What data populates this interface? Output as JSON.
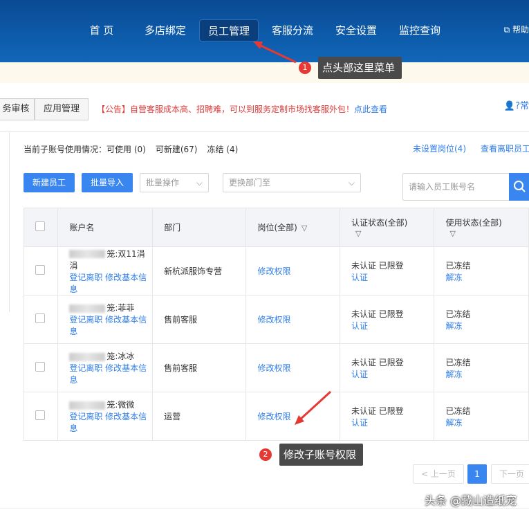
{
  "nav": {
    "items": [
      "首 页",
      "多店绑定",
      "员工管理",
      "客服分流",
      "安全设置",
      "监控查询"
    ],
    "active_index": 2,
    "help": "帮助"
  },
  "callouts": [
    {
      "num": "1",
      "text": "点头部这里菜单"
    },
    {
      "num": "2",
      "text": "修改子账号权限"
    }
  ],
  "tabs": [
    "务审核",
    "应用管理"
  ],
  "announcement": {
    "text": "【公告】自营客服成本高、招聘难，可以到服务定制市场找客服外包！",
    "link": "点此查看"
  },
  "question_help": "常",
  "stats": {
    "prefix": "当前子账号使用情况：",
    "available": "可使用 (0)",
    "can_create": "可新建(67)",
    "frozen": "冻结 (4)"
  },
  "right_links": [
    "未设置岗位(4)",
    "查看离职员工"
  ],
  "toolbar": {
    "new_employee": "新建员工",
    "batch_import": "批量导入",
    "batch_ops": "批量操作",
    "change_dept": "更换部门至",
    "search_placeholder": "请输入员工账号名"
  },
  "table": {
    "headers": [
      "账户名",
      "部门",
      "岗位(全部)",
      "认证状态(全部)",
      "使用状态(全部)"
    ],
    "rows": [
      {
        "name": "笼:双11涓涓",
        "actions": "登记离职 修改基本信息",
        "dept": "新杭派服饰专营",
        "role": "修改权限",
        "auth": "未认证 已限登",
        "auth_link": "认证",
        "state": "已冻结",
        "state_link": "解冻"
      },
      {
        "name": "笼:菲菲",
        "actions": "登记离职 修改基本信息",
        "dept": "售前客服",
        "role": "修改权限",
        "auth": "未认证 已限登",
        "auth_link": "认证",
        "state": "已冻结",
        "state_link": "解冻"
      },
      {
        "name": "笼:冰冰",
        "actions": "登记离职 修改基本信息",
        "dept": "售前客服",
        "role": "修改权限",
        "auth": "未认证 已限登",
        "auth_link": "认证",
        "state": "已冻结",
        "state_link": "解冻"
      },
      {
        "name": "笼:微微",
        "actions": "登记离职 修改基本信息",
        "dept": "运营",
        "role": "修改权限",
        "auth": "未认证 已限登",
        "auth_link": "认证",
        "state": "已冻结",
        "state_link": "解冻"
      }
    ]
  },
  "pagination": {
    "prev": "< 上一页",
    "current": "1",
    "next": "下一页"
  },
  "watermark": "头条 @藏山造纸宠",
  "colors": {
    "accent": "#3a86f0",
    "nav_bg": "#0d5cab",
    "alert": "#e53935"
  }
}
